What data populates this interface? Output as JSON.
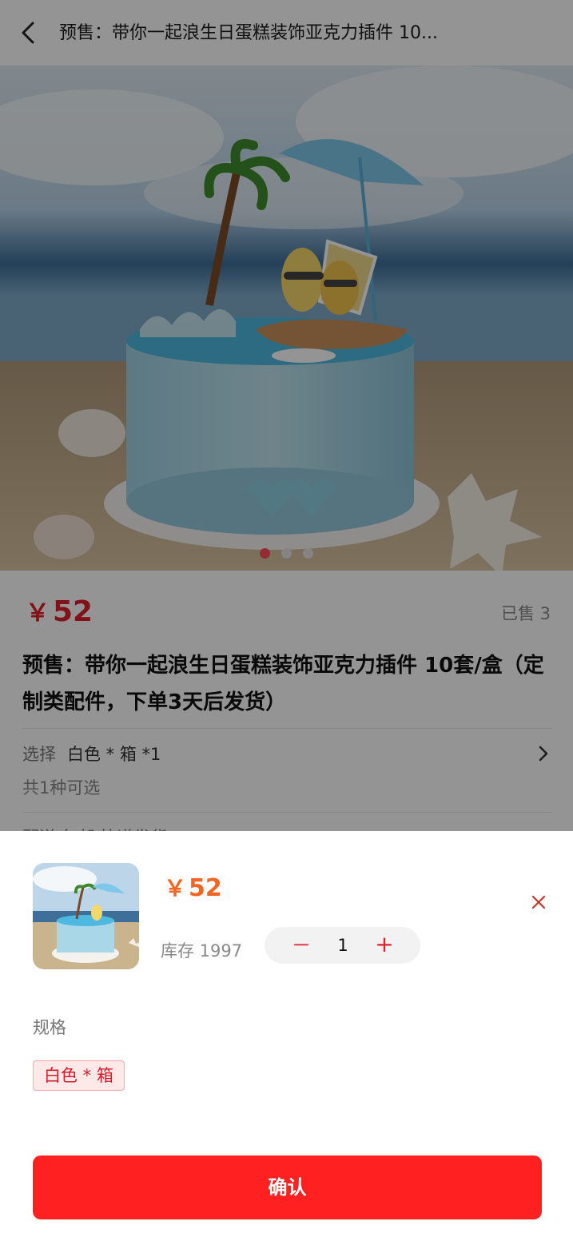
{
  "header": {
    "title": "预售：带你一起浪生日蛋糕装饰亚克力插件 10..."
  },
  "gallery": {
    "image": "cake-beach-photo",
    "dot_count": 3,
    "active_index": 0
  },
  "product": {
    "currency": "￥",
    "price": "52",
    "sold": "已售 3",
    "title": "预售：带你一起浪生日蛋糕装饰亚克力插件 10套/盒（定制类配件，下单3天后发货）",
    "select_label": "选择",
    "select_value": "白色 * 箱 *1",
    "select_sub": "共1种可选",
    "peek_row": "配送  包邮  快递发货"
  },
  "sheet": {
    "currency": "￥",
    "price": "52",
    "stock": "库存 1997",
    "minus": "−",
    "quantity": "1",
    "plus": "+",
    "spec_label": "规格",
    "spec_option": "白色 * 箱",
    "confirm": "确认"
  },
  "colors": {
    "accent": "#ff2121",
    "price_red": "#e0202b",
    "sheet_price_orange": "#f26522"
  }
}
